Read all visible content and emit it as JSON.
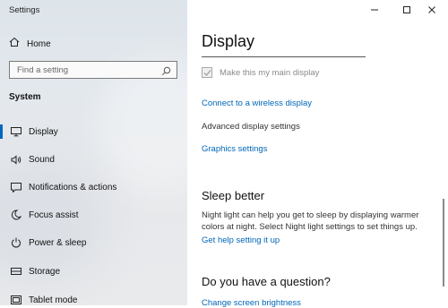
{
  "window": {
    "title": "Settings"
  },
  "sidebar": {
    "home_label": "Home",
    "search": {
      "placeholder": "Find a setting"
    },
    "section_label": "System",
    "items": [
      {
        "label": "Display",
        "icon": "monitor-icon",
        "active": true
      },
      {
        "label": "Sound",
        "icon": "speaker-icon"
      },
      {
        "label": "Notifications & actions",
        "icon": "notification-icon"
      },
      {
        "label": "Focus assist",
        "icon": "moon-icon"
      },
      {
        "label": "Power & sleep",
        "icon": "power-icon"
      },
      {
        "label": "Storage",
        "icon": "storage-icon"
      },
      {
        "label": "Tablet mode",
        "icon": "tablet-icon"
      }
    ]
  },
  "main": {
    "title": "Display",
    "main_display_checkbox": {
      "label": "Make this my main display",
      "checked": true,
      "disabled": true
    },
    "links": {
      "wireless": "Connect to a wireless display",
      "advanced": "Advanced display settings",
      "graphics": "Graphics settings"
    },
    "sleep": {
      "heading": "Sleep better",
      "text": "Night light can help you get to sleep by displaying warmer colors at night. Select Night light settings to set things up.",
      "link": "Get help setting it up"
    },
    "question": {
      "heading": "Do you have a question?",
      "link": "Change screen brightness"
    }
  },
  "colors": {
    "accent": "#0067b8",
    "active_indicator": "#0067c0"
  }
}
